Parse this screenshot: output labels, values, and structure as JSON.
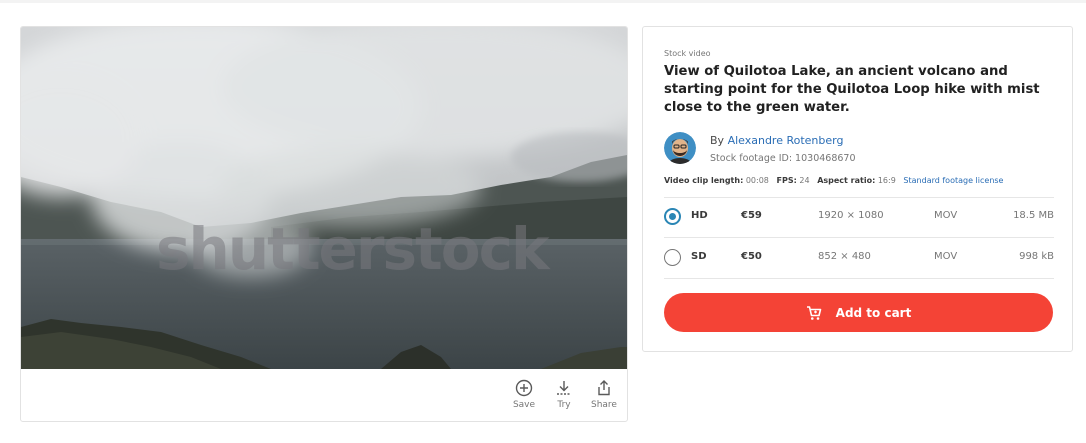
{
  "media": {
    "watermark": "shutterstock",
    "actions": [
      {
        "label": "Save",
        "icon": "plus-circle-icon"
      },
      {
        "label": "Try",
        "icon": "download-icon"
      },
      {
        "label": "Share",
        "icon": "share-icon"
      }
    ]
  },
  "details": {
    "content_type": "Stock video",
    "title": "View of Quilotoa Lake, an ancient volcano and starting point for the Quilotoa Loop hike with mist close to the green water.",
    "by_prefix": "By",
    "author": "Alexandre Rotenberg",
    "footage_id": "Stock footage ID: 1030468670",
    "meta": {
      "clip_length_label": "Video clip length:",
      "clip_length": "00:08",
      "fps_label": "FPS:",
      "fps": "24",
      "aspect_label": "Aspect ratio:",
      "aspect": "16:9",
      "license": "Standard footage license"
    },
    "options": [
      {
        "quality": "HD",
        "price": "€59",
        "resolution": "1920 × 1080",
        "format": "MOV",
        "size": "18.5 MB",
        "selected": true
      },
      {
        "quality": "SD",
        "price": "€50",
        "resolution": "852 × 480",
        "format": "MOV",
        "size": "998 kB",
        "selected": false
      }
    ],
    "add_to_cart": "Add to cart",
    "colors": {
      "accent": "#f44336",
      "link": "#2a6db5",
      "radio": "#2a86b5"
    }
  }
}
